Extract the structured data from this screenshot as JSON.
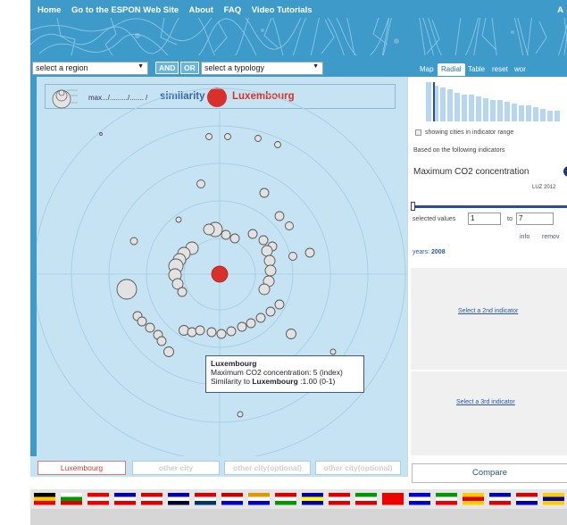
{
  "nav": {
    "items": [
      "Home",
      "Go to the ESPON Web Site",
      "About",
      "FAQ",
      "Video Tutorials"
    ],
    "corner_letter": "A"
  },
  "controls": {
    "region_select": "select a region",
    "and_label": "AND",
    "or_label": "OR",
    "typology_select": "select a typology",
    "tabs": [
      "Map",
      "Radial",
      "Table",
      "reset",
      "wor"
    ],
    "active_tab": "Radial"
  },
  "radial": {
    "header_text": "max.../........./....... /",
    "similarity_label": "similarity to",
    "reference_city": "Luxembourg",
    "legend_icon": "bubble-size-legend-icon"
  },
  "tooltip": {
    "city": "Luxembourg",
    "indicator_line": "Maximum CO2 concentration: 5 (index)",
    "similarity_prefix": "Similarity to",
    "similarity_city": "Luxembourg",
    "similarity_value": ":1.00 (0-1)"
  },
  "cities": {
    "primary": "Luxembourg",
    "second": "other city",
    "third": "other city(optional)",
    "fourth": "other city(optional)"
  },
  "right": {
    "showing_label": "showing cities in indicator range",
    "based_label": "Based on the following indicators",
    "indicator_name": "Maximum CO2 concentration",
    "indicator_sub": "LUZ 2012",
    "selected_label": "selected values",
    "from_value": "1",
    "to_label": "to",
    "to_value": "7",
    "info_link": "info",
    "remove_link": "remov",
    "years_label": "years:",
    "years_value": "2008",
    "second_indicator_link": "Select a 2nd indicator",
    "third_indicator_link": "Select a 3rd indicator",
    "compare_button": "Compare"
  },
  "colors": {
    "header_blue": "#3d9ac9",
    "panel_blue": "#c5e3f2",
    "reference_red": "#d9302a"
  }
}
